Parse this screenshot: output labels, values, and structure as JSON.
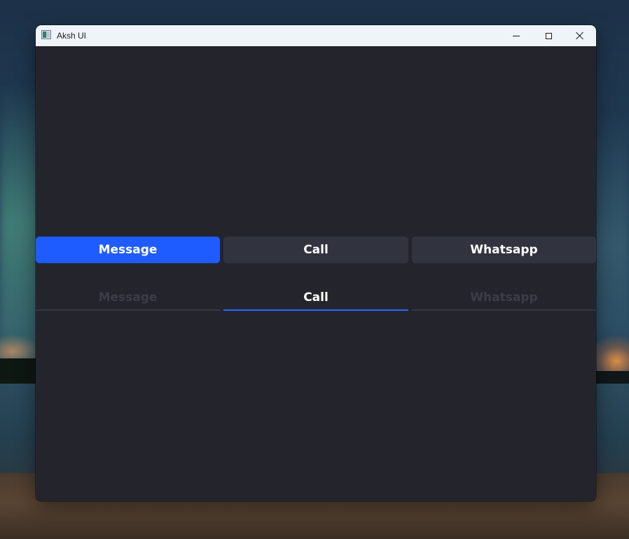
{
  "window": {
    "title": "Aksh UI"
  },
  "segmented": {
    "selected": "Call",
    "buttons": [
      {
        "label": "Message"
      },
      {
        "label": "Call"
      },
      {
        "label": "Whatsapp"
      }
    ]
  },
  "tabs": {
    "selected": "Call",
    "items": [
      {
        "label": "Message"
      },
      {
        "label": "Call"
      },
      {
        "label": "Whatsapp"
      }
    ]
  },
  "colors": {
    "accent": "#1f5cff",
    "tab_underline_active": "#2a66ff",
    "content_bg": "#24252c",
    "button_bg": "#31343f",
    "tab_inactive_text": "#3a3d47",
    "titlebar_bg": "#eff4f9"
  },
  "icons": {
    "app": "app-window-icon",
    "minimize": "minimize-icon",
    "maximize": "maximize-icon",
    "close": "close-icon"
  }
}
